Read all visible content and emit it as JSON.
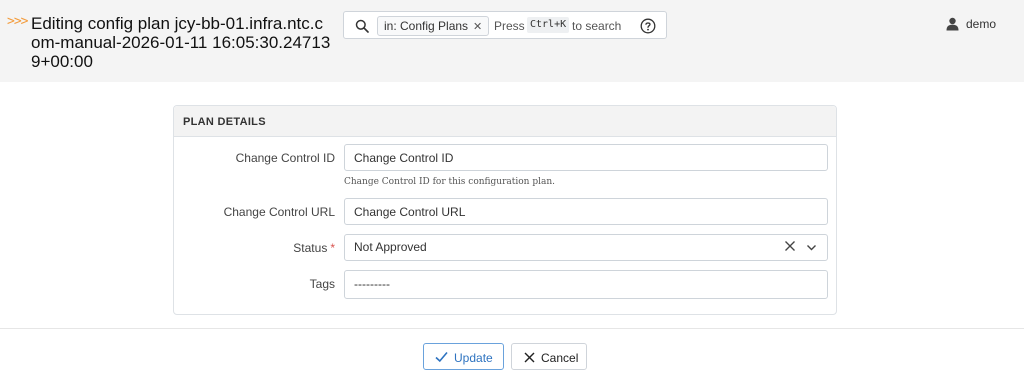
{
  "header": {
    "chevrons": ">>>",
    "title": "Editing config plan jcy-bb-01.infra.ntc.com-manual-2026-01-11 16:05:30.247139+00:00"
  },
  "search": {
    "scope_chip": "in: Config Plans",
    "press": "Press",
    "shortcut": "Ctrl+K",
    "hint": "to search"
  },
  "user": {
    "name": "demo"
  },
  "panel": {
    "title": "PLAN DETAILS",
    "fields": {
      "change_control_id": {
        "label": "Change Control ID",
        "placeholder": "Change Control ID",
        "help": "Change Control ID for this configuration plan."
      },
      "change_control_url": {
        "label": "Change Control URL",
        "placeholder": "Change Control URL"
      },
      "status": {
        "label": "Status",
        "required_mark": "*",
        "value": "Not Approved"
      },
      "tags": {
        "label": "Tags",
        "value": "---------"
      }
    }
  },
  "actions": {
    "update_label": "Update",
    "cancel_label": "Cancel"
  },
  "colors": {
    "accent": "#2e73c0",
    "chevrons": "#f39c3d",
    "required": "#d9534f"
  }
}
